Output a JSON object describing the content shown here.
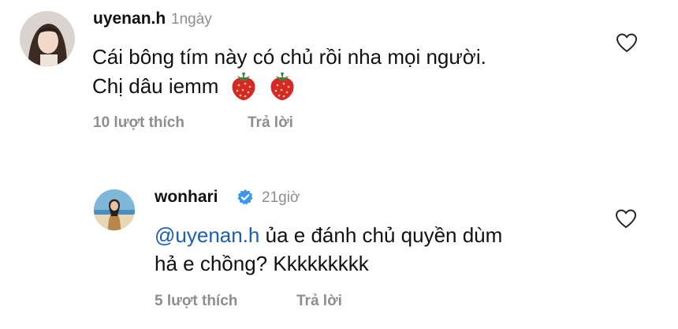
{
  "comments": [
    {
      "username": "uyenan.h",
      "time": "1ngày",
      "line1": "Cái bông tím này có chủ rồi nha mọi người.",
      "line2": "Chị dâu iemm",
      "emoji": [
        "strawberry-emoji",
        "strawberry-emoji"
      ],
      "likes": "10 lượt thích",
      "reply": "Trả lời"
    },
    {
      "username": "wonhari",
      "time": "21giờ",
      "mention": "@uyenan.h",
      "line1_rest": " ủa e đánh chủ quyền dùm",
      "line2": "hả e chồng? Kkkkkkkkk",
      "likes": "5 lượt thích",
      "reply": "Trả lời"
    }
  ],
  "colors": {
    "mention": "#1a5fb4",
    "secondary_text": "#8e8e8e",
    "verified": "#3897f0"
  }
}
